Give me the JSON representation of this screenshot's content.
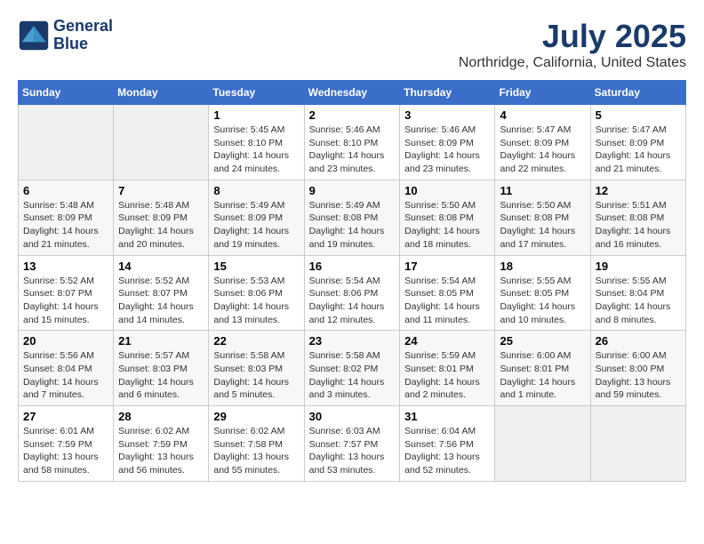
{
  "header": {
    "logo_line1": "General",
    "logo_line2": "Blue",
    "month": "July 2025",
    "location": "Northridge, California, United States"
  },
  "weekdays": [
    "Sunday",
    "Monday",
    "Tuesday",
    "Wednesday",
    "Thursday",
    "Friday",
    "Saturday"
  ],
  "weeks": [
    [
      {
        "day": "",
        "content": ""
      },
      {
        "day": "",
        "content": ""
      },
      {
        "day": "1",
        "content": "Sunrise: 5:45 AM\nSunset: 8:10 PM\nDaylight: 14 hours and 24 minutes."
      },
      {
        "day": "2",
        "content": "Sunrise: 5:46 AM\nSunset: 8:10 PM\nDaylight: 14 hours and 23 minutes."
      },
      {
        "day": "3",
        "content": "Sunrise: 5:46 AM\nSunset: 8:09 PM\nDaylight: 14 hours and 23 minutes."
      },
      {
        "day": "4",
        "content": "Sunrise: 5:47 AM\nSunset: 8:09 PM\nDaylight: 14 hours and 22 minutes."
      },
      {
        "day": "5",
        "content": "Sunrise: 5:47 AM\nSunset: 8:09 PM\nDaylight: 14 hours and 21 minutes."
      }
    ],
    [
      {
        "day": "6",
        "content": "Sunrise: 5:48 AM\nSunset: 8:09 PM\nDaylight: 14 hours and 21 minutes."
      },
      {
        "day": "7",
        "content": "Sunrise: 5:48 AM\nSunset: 8:09 PM\nDaylight: 14 hours and 20 minutes."
      },
      {
        "day": "8",
        "content": "Sunrise: 5:49 AM\nSunset: 8:09 PM\nDaylight: 14 hours and 19 minutes."
      },
      {
        "day": "9",
        "content": "Sunrise: 5:49 AM\nSunset: 8:08 PM\nDaylight: 14 hours and 19 minutes."
      },
      {
        "day": "10",
        "content": "Sunrise: 5:50 AM\nSunset: 8:08 PM\nDaylight: 14 hours and 18 minutes."
      },
      {
        "day": "11",
        "content": "Sunrise: 5:50 AM\nSunset: 8:08 PM\nDaylight: 14 hours and 17 minutes."
      },
      {
        "day": "12",
        "content": "Sunrise: 5:51 AM\nSunset: 8:08 PM\nDaylight: 14 hours and 16 minutes."
      }
    ],
    [
      {
        "day": "13",
        "content": "Sunrise: 5:52 AM\nSunset: 8:07 PM\nDaylight: 14 hours and 15 minutes."
      },
      {
        "day": "14",
        "content": "Sunrise: 5:52 AM\nSunset: 8:07 PM\nDaylight: 14 hours and 14 minutes."
      },
      {
        "day": "15",
        "content": "Sunrise: 5:53 AM\nSunset: 8:06 PM\nDaylight: 14 hours and 13 minutes."
      },
      {
        "day": "16",
        "content": "Sunrise: 5:54 AM\nSunset: 8:06 PM\nDaylight: 14 hours and 12 minutes."
      },
      {
        "day": "17",
        "content": "Sunrise: 5:54 AM\nSunset: 8:05 PM\nDaylight: 14 hours and 11 minutes."
      },
      {
        "day": "18",
        "content": "Sunrise: 5:55 AM\nSunset: 8:05 PM\nDaylight: 14 hours and 10 minutes."
      },
      {
        "day": "19",
        "content": "Sunrise: 5:55 AM\nSunset: 8:04 PM\nDaylight: 14 hours and 8 minutes."
      }
    ],
    [
      {
        "day": "20",
        "content": "Sunrise: 5:56 AM\nSunset: 8:04 PM\nDaylight: 14 hours and 7 minutes."
      },
      {
        "day": "21",
        "content": "Sunrise: 5:57 AM\nSunset: 8:03 PM\nDaylight: 14 hours and 6 minutes."
      },
      {
        "day": "22",
        "content": "Sunrise: 5:58 AM\nSunset: 8:03 PM\nDaylight: 14 hours and 5 minutes."
      },
      {
        "day": "23",
        "content": "Sunrise: 5:58 AM\nSunset: 8:02 PM\nDaylight: 14 hours and 3 minutes."
      },
      {
        "day": "24",
        "content": "Sunrise: 5:59 AM\nSunset: 8:01 PM\nDaylight: 14 hours and 2 minutes."
      },
      {
        "day": "25",
        "content": "Sunrise: 6:00 AM\nSunset: 8:01 PM\nDaylight: 14 hours and 1 minute."
      },
      {
        "day": "26",
        "content": "Sunrise: 6:00 AM\nSunset: 8:00 PM\nDaylight: 13 hours and 59 minutes."
      }
    ],
    [
      {
        "day": "27",
        "content": "Sunrise: 6:01 AM\nSunset: 7:59 PM\nDaylight: 13 hours and 58 minutes."
      },
      {
        "day": "28",
        "content": "Sunrise: 6:02 AM\nSunset: 7:59 PM\nDaylight: 13 hours and 56 minutes."
      },
      {
        "day": "29",
        "content": "Sunrise: 6:02 AM\nSunset: 7:58 PM\nDaylight: 13 hours and 55 minutes."
      },
      {
        "day": "30",
        "content": "Sunrise: 6:03 AM\nSunset: 7:57 PM\nDaylight: 13 hours and 53 minutes."
      },
      {
        "day": "31",
        "content": "Sunrise: 6:04 AM\nSunset: 7:56 PM\nDaylight: 13 hours and 52 minutes."
      },
      {
        "day": "",
        "content": ""
      },
      {
        "day": "",
        "content": ""
      }
    ]
  ]
}
